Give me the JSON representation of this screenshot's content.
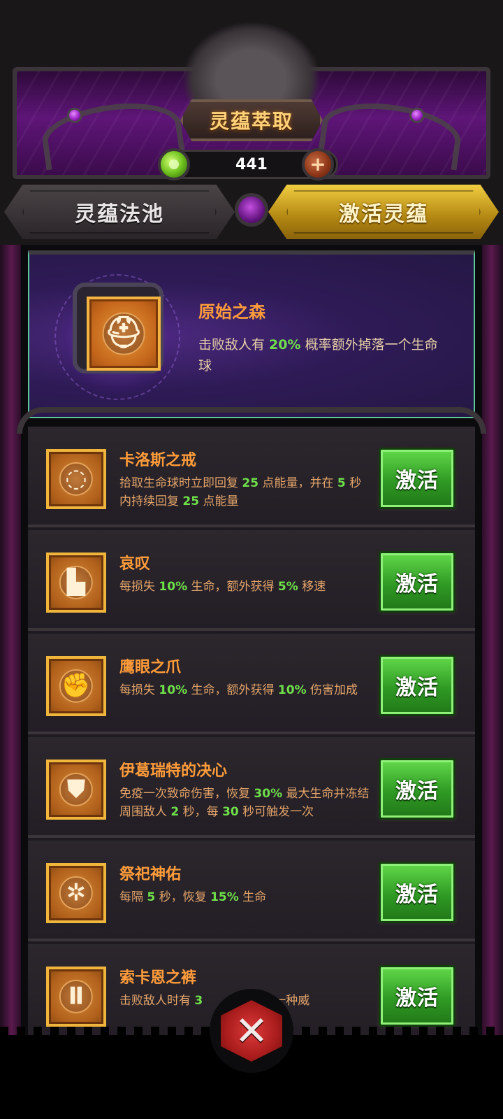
{
  "header": {
    "title": "灵蕴萃取",
    "currency_value": "441",
    "currency_icon": "green-orb-icon",
    "add_icon": "plus-icon"
  },
  "tabs": [
    {
      "label": "灵蕴法池",
      "active": false
    },
    {
      "label": "激活灵蕴",
      "active": true
    }
  ],
  "selected": {
    "name": "原始之森",
    "description": "击败敌人有 20% 概率额外掉落一个生命球",
    "icon": "helmet-icon"
  },
  "colors": {
    "accent_orange": "#ff9c3a",
    "highlight_green": "#6fe04a",
    "button_green": "#3aa62a",
    "tab_gold": "#d9ab22",
    "panel_purple": "#2f1b57"
  },
  "items": [
    {
      "name": "卡洛斯之戒",
      "description": "拾取生命球时立即回复 25 点能量，并在 5 秒内持续回复 25 点能量",
      "icon": "ring-icon",
      "button": "激活"
    },
    {
      "name": "哀叹",
      "description": "每损失 10% 生命，额外获得 5% 移速",
      "icon": "boot-icon",
      "button": "激活"
    },
    {
      "name": "鹰眼之爪",
      "description": "每损失 10% 生命，额外获得 10% 伤害加成",
      "icon": "fist-icon",
      "button": "激活"
    },
    {
      "name": "伊葛瑞特的决心",
      "description": "免疫一次致命伤害，恢复 30% 最大生命并冻结周围敌人 2 秒，每 30 秒可触发一次",
      "icon": "armor-icon",
      "button": "激活"
    },
    {
      "name": "祭祀神佑",
      "description": "每隔 5 秒，恢复 15% 生命",
      "icon": "beetle-icon",
      "button": "激活"
    },
    {
      "name": "索卡恩之裤",
      "description": "击败敌人时有 3 获得一种威",
      "icon": "pants-icon",
      "button": "激活"
    }
  ],
  "close": {
    "icon": "close-x-icon",
    "label": "✕"
  }
}
